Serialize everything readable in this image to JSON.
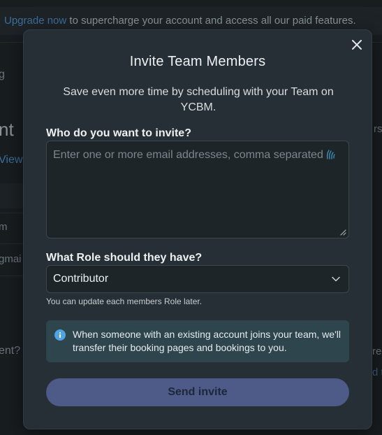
{
  "background": {
    "banner_link": "Upgrade now",
    "banner_text": " to supercharge your account and access all our paid features.",
    "fragments": {
      "a": "g",
      "b": "nt",
      "c": "View",
      "d": "m",
      "e": "gmai",
      "f": "ent?",
      "g": "rs",
      "h": "re",
      "i": "d t"
    }
  },
  "modal": {
    "title": "Invite Team Members",
    "subtitle": "Save even more time by scheduling with your Team on YCBM.",
    "invite_label": "Who do you want to invite?",
    "email_placeholder": "Enter one or more email addresses, comma separated",
    "email_value": "",
    "role_label": "What Role should they have?",
    "role_value": "Contributor",
    "role_hint": "You can update each members Role later.",
    "info_text": "When someone with an existing account joins your team, we'll transfer their booking pages and bookings to you.",
    "send_label": "Send invite"
  },
  "colors": {
    "modal_bg": "#252f35",
    "button_bg": "#4e5a88",
    "info_bg": "#2e454e",
    "info_icon": "#4fa3e0",
    "link": "#3c6f9a"
  },
  "icons": {
    "close": "close-icon",
    "grab": "password-manager-icon",
    "resize": "resize-handle-icon",
    "chevron": "chevron-down-icon",
    "info": "info-icon"
  }
}
